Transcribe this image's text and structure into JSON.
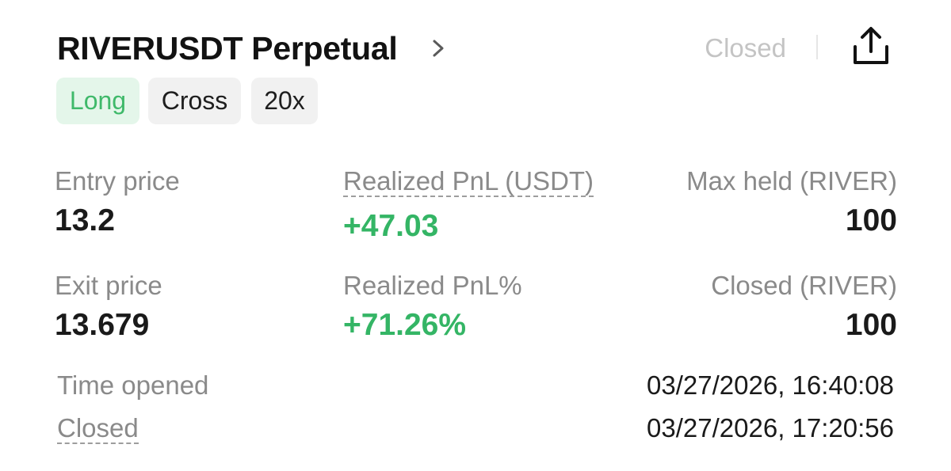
{
  "header": {
    "title": "RIVERUSDT Perpetual",
    "status": "Closed",
    "chevron_icon": "chevron-right-icon",
    "share_icon": "share-icon"
  },
  "tags": {
    "side": "Long",
    "margin_mode": "Cross",
    "leverage": "20x"
  },
  "stats": {
    "entry_price_label": "Entry price",
    "entry_price_value": "13.2",
    "realized_pnl_label": "Realized PnL (USDT)",
    "realized_pnl_value": "+47.03",
    "max_held_label": "Max held (RIVER)",
    "max_held_value": "100",
    "exit_price_label": "Exit price",
    "exit_price_value": "13.679",
    "realized_pnl_pct_label": "Realized PnL%",
    "realized_pnl_pct_value": "+71.26%",
    "closed_qty_label": "Closed (RIVER)",
    "closed_qty_value": "100"
  },
  "times": {
    "opened_label": "Time opened",
    "opened_value": "03/27/2026, 16:40:08",
    "closed_label": "Closed",
    "closed_value": "03/27/2026, 17:20:56"
  },
  "colors": {
    "profit_green": "#34b565",
    "long_tag_bg": "#e4f6ea",
    "neutral_tag_bg": "#f1f1f1",
    "label_gray": "#8a8a8a"
  }
}
